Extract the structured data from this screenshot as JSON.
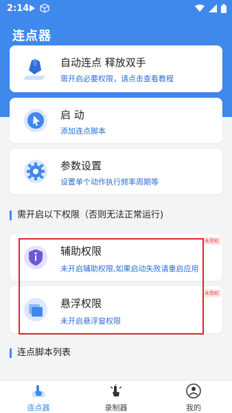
{
  "status": {
    "time": "2:14"
  },
  "app": {
    "title": "连点器"
  },
  "cards": [
    {
      "title": "自动连点 释放双手",
      "sub_prefix": "需开启必要权限，请点击",
      "sub_link": "查看教程"
    },
    {
      "title": "启 动",
      "sub": "添加连点脚本"
    },
    {
      "title": "参数设置",
      "sub": "设置单个动作执行频率周期等"
    }
  ],
  "permissions_section": {
    "title": "需开启以下权限（否则无法正常运行)"
  },
  "permissions": [
    {
      "title": "辅助权限",
      "sub": "未开启辅助权限,如果启动失败请重启应用",
      "badge": "未授权"
    },
    {
      "title": "悬浮权限",
      "sub": "未开启悬浮窗权限",
      "badge": "未授权"
    }
  ],
  "scripts_section": {
    "title": "连点脚本列表"
  },
  "nav": {
    "items": [
      {
        "label": "连点器"
      },
      {
        "label": "录制器"
      },
      {
        "label": "我的"
      }
    ]
  },
  "colors": {
    "accent": "#3f88ec",
    "link": "#2b6ed6",
    "highlight_border": "#e0202a",
    "badge": "#e24b4b"
  },
  "icons": {
    "status": [
      "notification-icon",
      "box-icon",
      "wifi-icon",
      "signal-icon",
      "battery-icon"
    ],
    "cards": [
      "hand-click-icon",
      "pointer-icon",
      "gear-icon"
    ],
    "permissions": [
      "shield-icon",
      "window-icon"
    ],
    "nav": [
      "tap-icon",
      "record-icon",
      "user-icon"
    ]
  }
}
